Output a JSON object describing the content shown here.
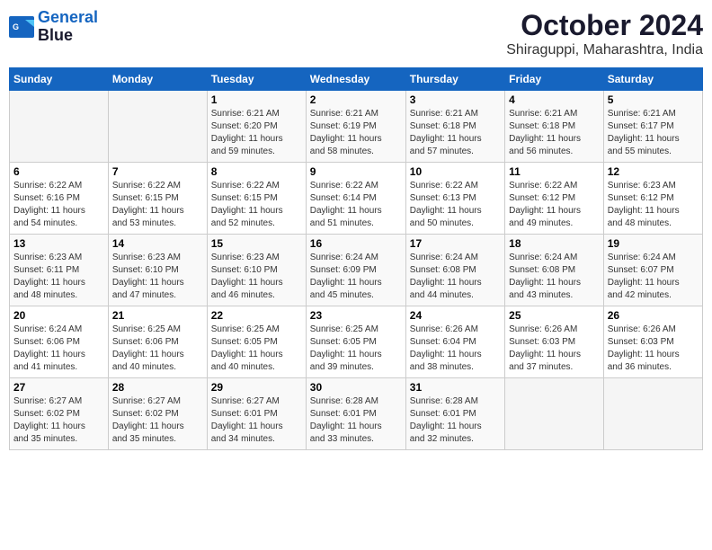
{
  "header": {
    "logo_line1": "General",
    "logo_line2": "Blue",
    "month": "October 2024",
    "location": "Shiraguppi, Maharashtra, India"
  },
  "weekdays": [
    "Sunday",
    "Monday",
    "Tuesday",
    "Wednesday",
    "Thursday",
    "Friday",
    "Saturday"
  ],
  "weeks": [
    [
      {
        "day": "",
        "detail": ""
      },
      {
        "day": "",
        "detail": ""
      },
      {
        "day": "1",
        "detail": "Sunrise: 6:21 AM\nSunset: 6:20 PM\nDaylight: 11 hours\nand 59 minutes."
      },
      {
        "day": "2",
        "detail": "Sunrise: 6:21 AM\nSunset: 6:19 PM\nDaylight: 11 hours\nand 58 minutes."
      },
      {
        "day": "3",
        "detail": "Sunrise: 6:21 AM\nSunset: 6:18 PM\nDaylight: 11 hours\nand 57 minutes."
      },
      {
        "day": "4",
        "detail": "Sunrise: 6:21 AM\nSunset: 6:18 PM\nDaylight: 11 hours\nand 56 minutes."
      },
      {
        "day": "5",
        "detail": "Sunrise: 6:21 AM\nSunset: 6:17 PM\nDaylight: 11 hours\nand 55 minutes."
      }
    ],
    [
      {
        "day": "6",
        "detail": "Sunrise: 6:22 AM\nSunset: 6:16 PM\nDaylight: 11 hours\nand 54 minutes."
      },
      {
        "day": "7",
        "detail": "Sunrise: 6:22 AM\nSunset: 6:15 PM\nDaylight: 11 hours\nand 53 minutes."
      },
      {
        "day": "8",
        "detail": "Sunrise: 6:22 AM\nSunset: 6:15 PM\nDaylight: 11 hours\nand 52 minutes."
      },
      {
        "day": "9",
        "detail": "Sunrise: 6:22 AM\nSunset: 6:14 PM\nDaylight: 11 hours\nand 51 minutes."
      },
      {
        "day": "10",
        "detail": "Sunrise: 6:22 AM\nSunset: 6:13 PM\nDaylight: 11 hours\nand 50 minutes."
      },
      {
        "day": "11",
        "detail": "Sunrise: 6:22 AM\nSunset: 6:12 PM\nDaylight: 11 hours\nand 49 minutes."
      },
      {
        "day": "12",
        "detail": "Sunrise: 6:23 AM\nSunset: 6:12 PM\nDaylight: 11 hours\nand 48 minutes."
      }
    ],
    [
      {
        "day": "13",
        "detail": "Sunrise: 6:23 AM\nSunset: 6:11 PM\nDaylight: 11 hours\nand 48 minutes."
      },
      {
        "day": "14",
        "detail": "Sunrise: 6:23 AM\nSunset: 6:10 PM\nDaylight: 11 hours\nand 47 minutes."
      },
      {
        "day": "15",
        "detail": "Sunrise: 6:23 AM\nSunset: 6:10 PM\nDaylight: 11 hours\nand 46 minutes."
      },
      {
        "day": "16",
        "detail": "Sunrise: 6:24 AM\nSunset: 6:09 PM\nDaylight: 11 hours\nand 45 minutes."
      },
      {
        "day": "17",
        "detail": "Sunrise: 6:24 AM\nSunset: 6:08 PM\nDaylight: 11 hours\nand 44 minutes."
      },
      {
        "day": "18",
        "detail": "Sunrise: 6:24 AM\nSunset: 6:08 PM\nDaylight: 11 hours\nand 43 minutes."
      },
      {
        "day": "19",
        "detail": "Sunrise: 6:24 AM\nSunset: 6:07 PM\nDaylight: 11 hours\nand 42 minutes."
      }
    ],
    [
      {
        "day": "20",
        "detail": "Sunrise: 6:24 AM\nSunset: 6:06 PM\nDaylight: 11 hours\nand 41 minutes."
      },
      {
        "day": "21",
        "detail": "Sunrise: 6:25 AM\nSunset: 6:06 PM\nDaylight: 11 hours\nand 40 minutes."
      },
      {
        "day": "22",
        "detail": "Sunrise: 6:25 AM\nSunset: 6:05 PM\nDaylight: 11 hours\nand 40 minutes."
      },
      {
        "day": "23",
        "detail": "Sunrise: 6:25 AM\nSunset: 6:05 PM\nDaylight: 11 hours\nand 39 minutes."
      },
      {
        "day": "24",
        "detail": "Sunrise: 6:26 AM\nSunset: 6:04 PM\nDaylight: 11 hours\nand 38 minutes."
      },
      {
        "day": "25",
        "detail": "Sunrise: 6:26 AM\nSunset: 6:03 PM\nDaylight: 11 hours\nand 37 minutes."
      },
      {
        "day": "26",
        "detail": "Sunrise: 6:26 AM\nSunset: 6:03 PM\nDaylight: 11 hours\nand 36 minutes."
      }
    ],
    [
      {
        "day": "27",
        "detail": "Sunrise: 6:27 AM\nSunset: 6:02 PM\nDaylight: 11 hours\nand 35 minutes."
      },
      {
        "day": "28",
        "detail": "Sunrise: 6:27 AM\nSunset: 6:02 PM\nDaylight: 11 hours\nand 35 minutes."
      },
      {
        "day": "29",
        "detail": "Sunrise: 6:27 AM\nSunset: 6:01 PM\nDaylight: 11 hours\nand 34 minutes."
      },
      {
        "day": "30",
        "detail": "Sunrise: 6:28 AM\nSunset: 6:01 PM\nDaylight: 11 hours\nand 33 minutes."
      },
      {
        "day": "31",
        "detail": "Sunrise: 6:28 AM\nSunset: 6:01 PM\nDaylight: 11 hours\nand 32 minutes."
      },
      {
        "day": "",
        "detail": ""
      },
      {
        "day": "",
        "detail": ""
      }
    ]
  ]
}
